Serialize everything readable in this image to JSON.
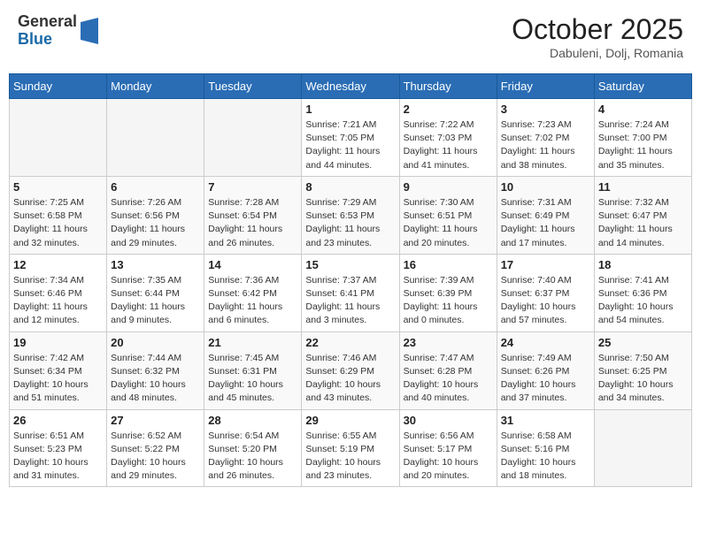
{
  "header": {
    "logo": {
      "general": "General",
      "blue": "Blue"
    },
    "title": "October 2025",
    "location": "Dabuleni, Dolj, Romania"
  },
  "weekdays": [
    "Sunday",
    "Monday",
    "Tuesday",
    "Wednesday",
    "Thursday",
    "Friday",
    "Saturday"
  ],
  "weeks": [
    [
      {
        "day": "",
        "info": ""
      },
      {
        "day": "",
        "info": ""
      },
      {
        "day": "",
        "info": ""
      },
      {
        "day": "1",
        "info": "Sunrise: 7:21 AM\nSunset: 7:05 PM\nDaylight: 11 hours and 44 minutes."
      },
      {
        "day": "2",
        "info": "Sunrise: 7:22 AM\nSunset: 7:03 PM\nDaylight: 11 hours and 41 minutes."
      },
      {
        "day": "3",
        "info": "Sunrise: 7:23 AM\nSunset: 7:02 PM\nDaylight: 11 hours and 38 minutes."
      },
      {
        "day": "4",
        "info": "Sunrise: 7:24 AM\nSunset: 7:00 PM\nDaylight: 11 hours and 35 minutes."
      }
    ],
    [
      {
        "day": "5",
        "info": "Sunrise: 7:25 AM\nSunset: 6:58 PM\nDaylight: 11 hours and 32 minutes."
      },
      {
        "day": "6",
        "info": "Sunrise: 7:26 AM\nSunset: 6:56 PM\nDaylight: 11 hours and 29 minutes."
      },
      {
        "day": "7",
        "info": "Sunrise: 7:28 AM\nSunset: 6:54 PM\nDaylight: 11 hours and 26 minutes."
      },
      {
        "day": "8",
        "info": "Sunrise: 7:29 AM\nSunset: 6:53 PM\nDaylight: 11 hours and 23 minutes."
      },
      {
        "day": "9",
        "info": "Sunrise: 7:30 AM\nSunset: 6:51 PM\nDaylight: 11 hours and 20 minutes."
      },
      {
        "day": "10",
        "info": "Sunrise: 7:31 AM\nSunset: 6:49 PM\nDaylight: 11 hours and 17 minutes."
      },
      {
        "day": "11",
        "info": "Sunrise: 7:32 AM\nSunset: 6:47 PM\nDaylight: 11 hours and 14 minutes."
      }
    ],
    [
      {
        "day": "12",
        "info": "Sunrise: 7:34 AM\nSunset: 6:46 PM\nDaylight: 11 hours and 12 minutes."
      },
      {
        "day": "13",
        "info": "Sunrise: 7:35 AM\nSunset: 6:44 PM\nDaylight: 11 hours and 9 minutes."
      },
      {
        "day": "14",
        "info": "Sunrise: 7:36 AM\nSunset: 6:42 PM\nDaylight: 11 hours and 6 minutes."
      },
      {
        "day": "15",
        "info": "Sunrise: 7:37 AM\nSunset: 6:41 PM\nDaylight: 11 hours and 3 minutes."
      },
      {
        "day": "16",
        "info": "Sunrise: 7:39 AM\nSunset: 6:39 PM\nDaylight: 11 hours and 0 minutes."
      },
      {
        "day": "17",
        "info": "Sunrise: 7:40 AM\nSunset: 6:37 PM\nDaylight: 10 hours and 57 minutes."
      },
      {
        "day": "18",
        "info": "Sunrise: 7:41 AM\nSunset: 6:36 PM\nDaylight: 10 hours and 54 minutes."
      }
    ],
    [
      {
        "day": "19",
        "info": "Sunrise: 7:42 AM\nSunset: 6:34 PM\nDaylight: 10 hours and 51 minutes."
      },
      {
        "day": "20",
        "info": "Sunrise: 7:44 AM\nSunset: 6:32 PM\nDaylight: 10 hours and 48 minutes."
      },
      {
        "day": "21",
        "info": "Sunrise: 7:45 AM\nSunset: 6:31 PM\nDaylight: 10 hours and 45 minutes."
      },
      {
        "day": "22",
        "info": "Sunrise: 7:46 AM\nSunset: 6:29 PM\nDaylight: 10 hours and 43 minutes."
      },
      {
        "day": "23",
        "info": "Sunrise: 7:47 AM\nSunset: 6:28 PM\nDaylight: 10 hours and 40 minutes."
      },
      {
        "day": "24",
        "info": "Sunrise: 7:49 AM\nSunset: 6:26 PM\nDaylight: 10 hours and 37 minutes."
      },
      {
        "day": "25",
        "info": "Sunrise: 7:50 AM\nSunset: 6:25 PM\nDaylight: 10 hours and 34 minutes."
      }
    ],
    [
      {
        "day": "26",
        "info": "Sunrise: 6:51 AM\nSunset: 5:23 PM\nDaylight: 10 hours and 31 minutes."
      },
      {
        "day": "27",
        "info": "Sunrise: 6:52 AM\nSunset: 5:22 PM\nDaylight: 10 hours and 29 minutes."
      },
      {
        "day": "28",
        "info": "Sunrise: 6:54 AM\nSunset: 5:20 PM\nDaylight: 10 hours and 26 minutes."
      },
      {
        "day": "29",
        "info": "Sunrise: 6:55 AM\nSunset: 5:19 PM\nDaylight: 10 hours and 23 minutes."
      },
      {
        "day": "30",
        "info": "Sunrise: 6:56 AM\nSunset: 5:17 PM\nDaylight: 10 hours and 20 minutes."
      },
      {
        "day": "31",
        "info": "Sunrise: 6:58 AM\nSunset: 5:16 PM\nDaylight: 10 hours and 18 minutes."
      },
      {
        "day": "",
        "info": ""
      }
    ]
  ]
}
